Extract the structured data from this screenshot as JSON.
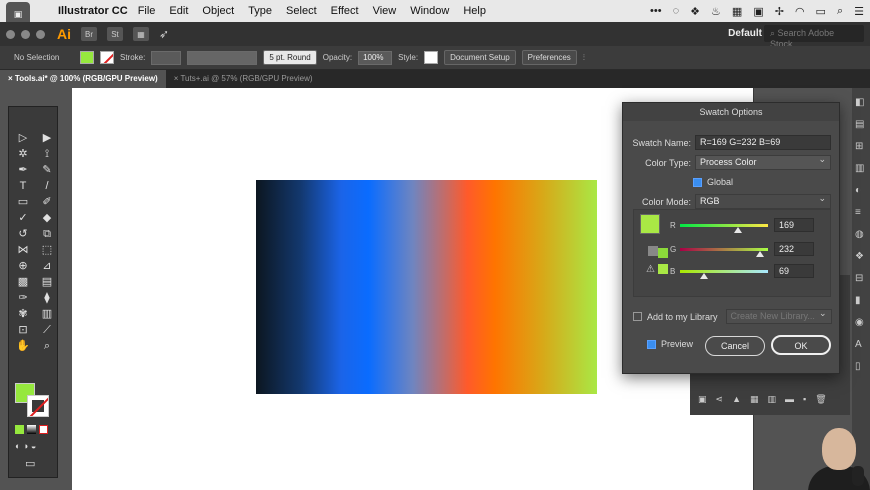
{
  "menubar": {
    "app_name": "Illustrator CC",
    "items": [
      "File",
      "Edit",
      "Object",
      "Type",
      "Select",
      "Effect",
      "View",
      "Window",
      "Help"
    ]
  },
  "appbar": {
    "logo": "Ai",
    "bridge": "Br",
    "stock": "St",
    "workspace": "Default",
    "search_placeholder": "Search Adobe Stock"
  },
  "controlbar": {
    "selection_label": "No Selection",
    "stroke_label": "Stroke:",
    "brush_label": "5 pt. Round",
    "opacity_label": "Opacity:",
    "opacity_value": "100%",
    "style_label": "Style:",
    "document_setup": "Document Setup",
    "preferences": "Preferences"
  },
  "tabs": [
    {
      "label": "Tools.ai* @ 100% (RGB/GPU Preview)"
    },
    {
      "label": "Tuts+.ai @ 57% (RGB/GPU Preview)"
    }
  ],
  "dialog": {
    "title": "Swatch Options",
    "swatch_name_label": "Swatch Name:",
    "swatch_name": "R=169 G=232 B=69",
    "color_type_label": "Color Type:",
    "color_type": "Process Color",
    "global_label": "Global",
    "color_mode_label": "Color Mode:",
    "color_mode": "RGB",
    "r": {
      "label": "R",
      "value": "169",
      "level": 0.663
    },
    "g": {
      "label": "G",
      "value": "232",
      "level": 0.91
    },
    "b": {
      "label": "B",
      "value": "69",
      "level": 0.27
    },
    "add_library_label": "Add to my Library",
    "library_placeholder": "Create New Library...",
    "preview_label": "Preview",
    "cancel": "Cancel",
    "ok": "OK"
  },
  "colors": {
    "swatch": "#a9e845",
    "accent_blue": "#3a8ef0",
    "stroke_none_red": "#e02020"
  }
}
